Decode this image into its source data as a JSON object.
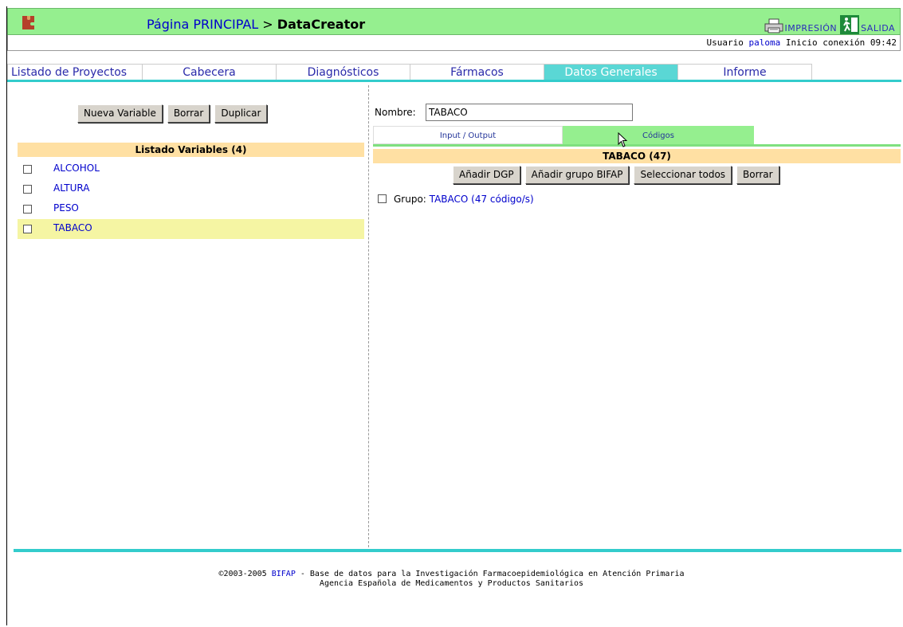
{
  "header": {
    "breadcrumb_home": "Página PRINCIPAL",
    "breadcrumb_sep": ">",
    "breadcrumb_current": "DataCreator",
    "print_label": "IMPRESIÓN",
    "exit_label": "SALIDA",
    "logo_icon": "puzzle-logo-icon",
    "print_icon": "printer-icon",
    "exit_icon": "exit-door-icon"
  },
  "userbar": {
    "prefix": "Usuario",
    "username": "paloma",
    "login_label": "Inicio conexión",
    "login_time": "09:42"
  },
  "tabs": [
    {
      "label": "Listado de Proyectos"
    },
    {
      "label": "Cabecera"
    },
    {
      "label": "Diagnósticos"
    },
    {
      "label": "Fármacos"
    },
    {
      "label": "Datos Generales"
    },
    {
      "label": "Informe"
    }
  ],
  "left": {
    "buttons": {
      "new": "Nueva Variable",
      "delete": "Borrar",
      "duplicate": "Duplicar"
    },
    "list_header": "Listado Variables (4)",
    "variables": [
      {
        "label": "ALCOHOL"
      },
      {
        "label": "ALTURA"
      },
      {
        "label": "PESO"
      },
      {
        "label": "TABACO"
      }
    ]
  },
  "right": {
    "name_label": "Nombre:",
    "name_value": "TABACO",
    "subtabs": [
      {
        "label": "Input / Output"
      },
      {
        "label": "Códigos"
      }
    ],
    "codes_header": "TABACO (47)",
    "buttons": {
      "add_dgp": "Añadir DGP",
      "add_group": "Añadir grupo BIFAP",
      "select_all": "Seleccionar todos",
      "delete": "Borrar"
    },
    "group_prefix": "Grupo:",
    "group_link": "TABACO (47 código/s)"
  },
  "footer": {
    "copyright": "©2003-2005",
    "link": "BIFAP",
    "line1_rest": " - Base de datos para la Investigación Farmacoepidemiológica en Atención Primaria",
    "line2": "Agencia Española de Medicamentos y Productos Sanitarios"
  },
  "colors": {
    "header_green": "#95ef8f",
    "tab_active": "#5ad7d5",
    "accent_teal": "#33cccc",
    "section_header": "#ffe0a3",
    "selected_row": "#f5f5a3",
    "link_blue": "#0000cc"
  }
}
